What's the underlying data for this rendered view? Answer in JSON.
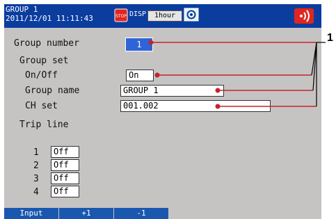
{
  "header": {
    "group": "GROUP 1",
    "datetime": "2011/12/01 11:11:43",
    "stop_label": "STOP",
    "disp_label": "DISP",
    "trend_interval": "1hour",
    "icons": [
      "stop-icon",
      "camera-icon",
      "alarm-icon"
    ],
    "colors": {
      "title_bg": "#0b3d9f",
      "alarm": "#e0261f"
    }
  },
  "form": {
    "group_number_label": "Group number",
    "group_number_value": "1",
    "group_set_label": "Group set",
    "onoff_label": "On/Off",
    "onoff_value": "On",
    "group_name_label": "Group name",
    "group_name_value": "GROUP 1",
    "ch_set_label": "CH set",
    "ch_set_value": "001.002",
    "trip_line_label": "Trip line",
    "trip_lines": [
      {
        "num": "1",
        "value": "Off"
      },
      {
        "num": "2",
        "value": "Off"
      },
      {
        "num": "3",
        "value": "Off"
      },
      {
        "num": "4",
        "value": "Off"
      }
    ]
  },
  "softkeys": [
    "Input",
    "+1",
    "-1"
  ],
  "callout": "1"
}
